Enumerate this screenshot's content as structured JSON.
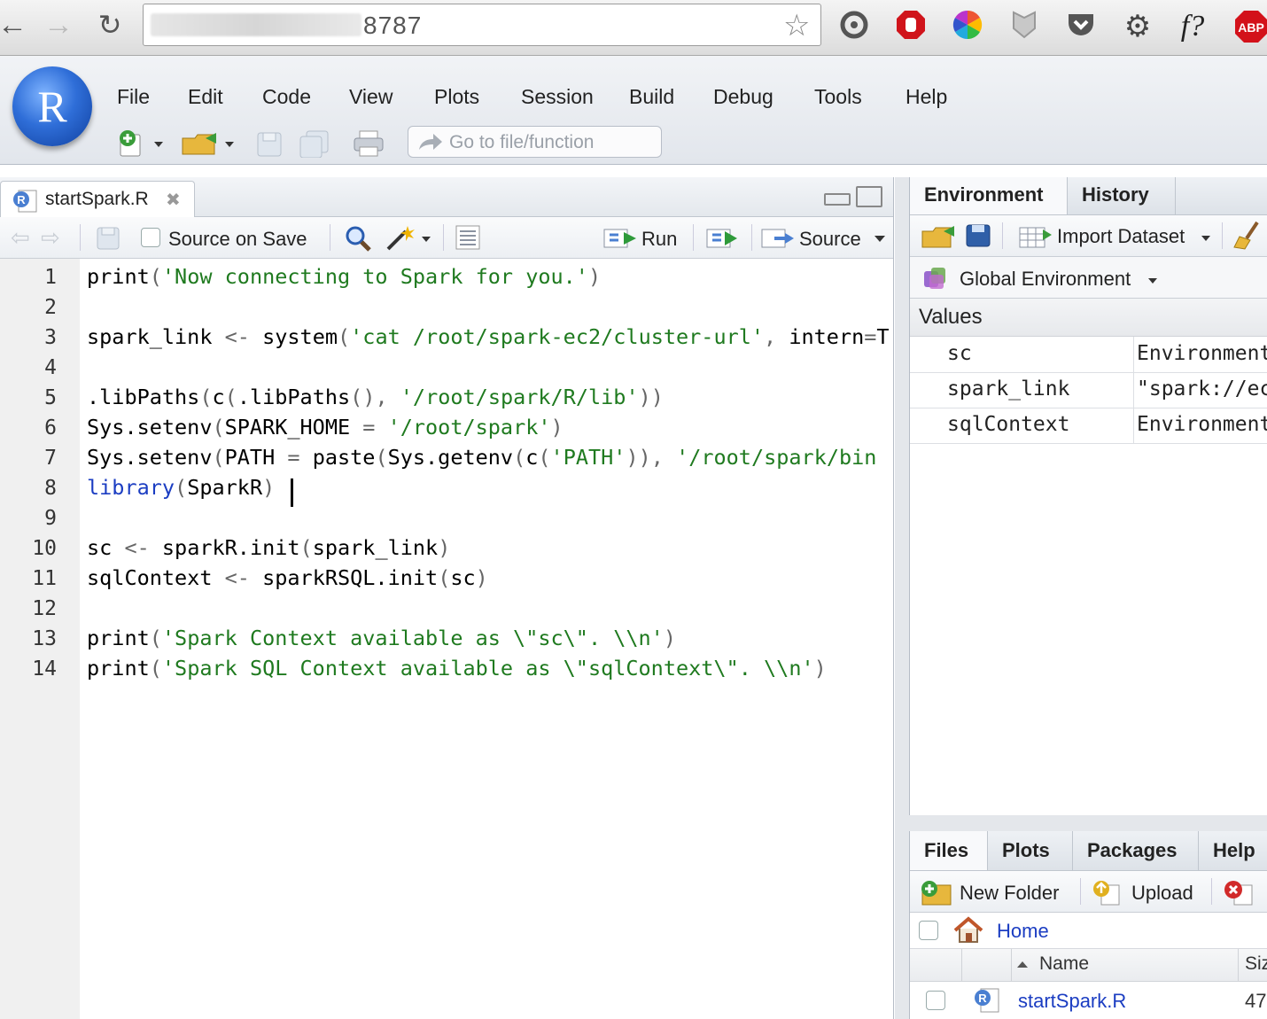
{
  "browser": {
    "address_visible": "8787"
  },
  "menu": [
    "File",
    "Edit",
    "Code",
    "View",
    "Plots",
    "Session",
    "Build",
    "Debug",
    "Tools",
    "Help"
  ],
  "toolbar": {
    "goto_placeholder": "Go to file/function"
  },
  "editor": {
    "tab_label": "startSpark.R",
    "source_on_save": "Source on Save",
    "run_label": "Run",
    "source_label": "Source",
    "lines": [
      "print('Now connecting to Spark for you.')",
      "",
      "spark_link <- system('cat /root/spark-ec2/cluster-url', intern=T",
      "",
      ".libPaths(c(.libPaths(), '/root/spark/R/lib'))",
      "Sys.setenv(SPARK_HOME = '/root/spark')",
      "Sys.setenv(PATH = paste(Sys.getenv(c('PATH')), '/root/spark/bin",
      "library(SparkR)",
      "",
      "sc <- sparkR.init(spark_link)",
      "sqlContext <- sparkRSQL.init(sc)",
      "",
      "print('Spark Context available as \\\"sc\\\". \\\\n')",
      "print('Spark SQL Context available as \\\"sqlContext\\\". \\\\n')"
    ],
    "line_numbers": [
      "1",
      "2",
      "3",
      "4",
      "5",
      "6",
      "7",
      "8",
      "9",
      "10",
      "11",
      "12",
      "13",
      "14"
    ]
  },
  "env": {
    "tabs": [
      "Environment",
      "History"
    ],
    "import_dataset": "Import Dataset",
    "scope": "Global Environment",
    "values_header": "Values",
    "rows": [
      {
        "name": "sc",
        "value": "Environment"
      },
      {
        "name": "spark_link",
        "value": "\"spark://ec"
      },
      {
        "name": "sqlContext",
        "value": "Environment"
      }
    ]
  },
  "files": {
    "tabs": [
      "Files",
      "Plots",
      "Packages",
      "Help"
    ],
    "new_folder": "New Folder",
    "upload": "Upload",
    "path_home": "Home",
    "col_name": "Name",
    "col_size": "Siz",
    "file_name": "startSpark.R",
    "file_size": "47"
  },
  "colors": {
    "string": "#1f7a1f",
    "keyword": "#1b3dc2",
    "accent": "#2f6ed8"
  }
}
